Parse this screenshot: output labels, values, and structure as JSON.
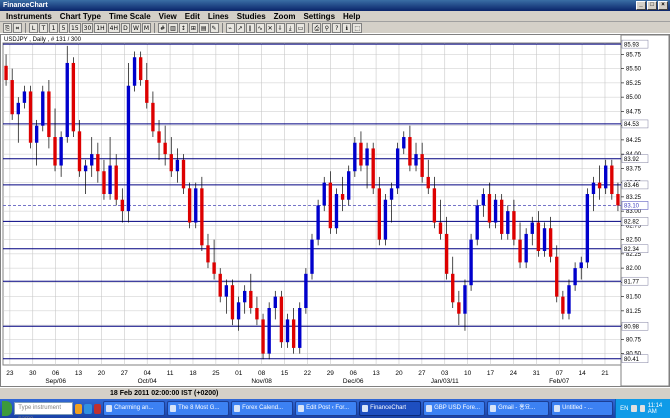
{
  "window": {
    "title": "FinanceChart"
  },
  "menu": [
    "Instruments",
    "Chart Type",
    "Time Scale",
    "View",
    "Edit",
    "Lines",
    "Studies",
    "Zoom",
    "Settings",
    "Help"
  ],
  "toolbar": {
    "buttons": [
      "⎘",
      "⌗",
      "L",
      "T",
      "1",
      "5",
      "15",
      "30",
      "1H",
      "4H",
      "D",
      "W",
      "M",
      "#",
      "▥",
      "↕",
      "⊞",
      "▤",
      "✎",
      "⌁",
      "↗",
      "∥",
      "∿",
      "✕",
      "⇩",
      "⤓",
      "▭",
      "⎙",
      "⚲",
      "?",
      "ℹ",
      "⬚"
    ]
  },
  "chart_info": "USDJPY , Daily , # 131 / 300",
  "status": {
    "datetime": "18 Feb 2011 02:00:00  IST (+0200)"
  },
  "taskbar": {
    "search_placeholder": "Type instrument name",
    "items": [
      "Charming an...",
      "The 8 Most G...",
      "Forex Calend...",
      "Edit Post ‹ For...",
      "FinanceChart",
      "GBP USD Fore...",
      "Gmail - 홍요...",
      "Untitled - ..."
    ],
    "active_index": 4,
    "language": "EN",
    "clock": "11:14 AM"
  },
  "colors": {
    "bull": "#0000cc",
    "bear": "#dd0000",
    "support_line": "#000080",
    "current_line": "#6060c0",
    "grid": "#c8c8c8"
  },
  "chart_data": {
    "type": "candlestick",
    "instrument": "USDJPY",
    "timeframe": "Daily",
    "ylim": [
      80.3,
      85.95
    ],
    "y_ticks": [
      80.5,
      80.75,
      81.0,
      81.25,
      81.5,
      81.75,
      82.0,
      82.25,
      82.5,
      82.75,
      83.0,
      83.25,
      83.5,
      83.75,
      84.0,
      84.25,
      84.5,
      84.75,
      85.0,
      85.25,
      85.5,
      85.75
    ],
    "horizontal_levels": [
      85.93,
      84.53,
      83.92,
      83.46,
      82.82,
      82.34,
      81.77,
      80.98,
      80.41
    ],
    "current_price": 83.1,
    "x_day_labels": [
      "23",
      "30",
      "06",
      "13",
      "20",
      "27",
      "04",
      "11",
      "18",
      "25",
      "01",
      "08",
      "15",
      "22",
      "29",
      "06",
      "13",
      "20",
      "27",
      "03",
      "10",
      "17",
      "24",
      "31",
      "07",
      "14",
      "21"
    ],
    "x_month_labels": [
      {
        "label": "Sep/06",
        "at": "06"
      },
      {
        "label": "Oct/04",
        "at": "04"
      },
      {
        "label": "Nov/08",
        "at": "08"
      },
      {
        "label": "Dec/06",
        "at": "06"
      },
      {
        "label": "Jan/03/11",
        "at": "03"
      },
      {
        "label": "Feb/07",
        "at": "07"
      }
    ],
    "candles": [
      [
        85.55,
        85.75,
        85.2,
        85.3
      ],
      [
        85.3,
        85.5,
        84.6,
        84.7
      ],
      [
        84.7,
        85.0,
        84.2,
        84.9
      ],
      [
        84.9,
        85.2,
        84.8,
        85.1
      ],
      [
        85.1,
        85.2,
        84.1,
        84.2
      ],
      [
        84.2,
        84.6,
        83.8,
        84.5
      ],
      [
        84.5,
        85.2,
        84.4,
        85.1
      ],
      [
        85.1,
        85.3,
        84.1,
        84.3
      ],
      [
        84.3,
        84.8,
        83.7,
        83.8
      ],
      [
        83.8,
        84.4,
        83.6,
        84.3
      ],
      [
        84.3,
        85.9,
        84.2,
        85.6
      ],
      [
        85.6,
        85.7,
        84.3,
        84.4
      ],
      [
        84.4,
        84.6,
        83.6,
        83.7
      ],
      [
        83.7,
        83.9,
        83.3,
        83.8
      ],
      [
        83.8,
        84.3,
        83.6,
        84.0
      ],
      [
        84.0,
        84.2,
        83.5,
        83.7
      ],
      [
        83.7,
        83.9,
        83.2,
        83.3
      ],
      [
        83.3,
        84.3,
        83.2,
        83.8
      ],
      [
        83.8,
        84.0,
        83.1,
        83.2
      ],
      [
        83.2,
        83.4,
        82.8,
        83.0
      ],
      [
        83.0,
        85.6,
        82.8,
        85.2
      ],
      [
        85.2,
        85.8,
        85.1,
        85.7
      ],
      [
        85.7,
        85.8,
        85.2,
        85.3
      ],
      [
        85.3,
        85.6,
        84.8,
        84.9
      ],
      [
        84.9,
        85.1,
        84.3,
        84.4
      ],
      [
        84.4,
        84.6,
        83.9,
        84.2
      ],
      [
        84.2,
        84.5,
        83.8,
        84.0
      ],
      [
        84.0,
        84.3,
        83.6,
        83.7
      ],
      [
        83.7,
        84.1,
        83.5,
        83.9
      ],
      [
        83.9,
        84.0,
        83.3,
        83.4
      ],
      [
        83.4,
        83.5,
        82.7,
        82.8
      ],
      [
        82.8,
        83.5,
        82.7,
        83.4
      ],
      [
        83.4,
        83.6,
        82.3,
        82.4
      ],
      [
        82.4,
        82.6,
        82.0,
        82.1
      ],
      [
        82.1,
        82.5,
        81.8,
        81.9
      ],
      [
        81.9,
        82.0,
        81.4,
        81.5
      ],
      [
        81.5,
        81.8,
        81.2,
        81.7
      ],
      [
        81.7,
        81.8,
        81.0,
        81.1
      ],
      [
        81.1,
        81.5,
        80.9,
        81.4
      ],
      [
        81.4,
        81.7,
        81.2,
        81.6
      ],
      [
        81.6,
        81.9,
        81.2,
        81.3
      ],
      [
        81.3,
        81.5,
        81.0,
        81.1
      ],
      [
        81.1,
        81.2,
        80.4,
        80.5
      ],
      [
        80.5,
        81.4,
        80.4,
        81.3
      ],
      [
        81.3,
        81.6,
        81.1,
        81.5
      ],
      [
        81.5,
        81.6,
        80.6,
        80.7
      ],
      [
        80.7,
        81.2,
        80.6,
        81.1
      ],
      [
        81.1,
        81.3,
        80.5,
        80.6
      ],
      [
        80.6,
        81.4,
        80.5,
        81.3
      ],
      [
        81.3,
        82.0,
        81.2,
        81.9
      ],
      [
        81.9,
        82.6,
        81.8,
        82.5
      ],
      [
        82.5,
        83.2,
        82.4,
        83.1
      ],
      [
        83.1,
        83.6,
        83.0,
        83.5
      ],
      [
        83.5,
        83.7,
        82.6,
        82.7
      ],
      [
        82.7,
        83.4,
        82.6,
        83.3
      ],
      [
        83.3,
        83.6,
        83.0,
        83.2
      ],
      [
        83.2,
        83.8,
        83.1,
        83.7
      ],
      [
        83.7,
        84.3,
        83.6,
        84.2
      ],
      [
        84.2,
        84.4,
        83.7,
        83.8
      ],
      [
        83.8,
        84.2,
        83.4,
        84.1
      ],
      [
        84.1,
        84.2,
        83.3,
        83.4
      ],
      [
        83.4,
        83.6,
        82.4,
        82.5
      ],
      [
        82.5,
        83.3,
        82.4,
        83.2
      ],
      [
        83.2,
        83.5,
        82.8,
        83.4
      ],
      [
        83.4,
        84.2,
        83.3,
        84.1
      ],
      [
        84.1,
        84.4,
        84.0,
        84.3
      ],
      [
        84.3,
        84.5,
        83.7,
        83.8
      ],
      [
        83.8,
        84.2,
        83.7,
        84.0
      ],
      [
        84.0,
        84.2,
        83.5,
        83.6
      ],
      [
        83.6,
        83.9,
        83.3,
        83.4
      ],
      [
        83.4,
        83.6,
        82.7,
        82.8
      ],
      [
        82.8,
        83.2,
        82.5,
        82.6
      ],
      [
        82.6,
        82.9,
        81.8,
        81.9
      ],
      [
        81.9,
        82.2,
        81.3,
        81.4
      ],
      [
        81.4,
        81.6,
        81.0,
        81.2
      ],
      [
        81.2,
        81.8,
        80.9,
        81.7
      ],
      [
        81.7,
        82.6,
        81.6,
        82.5
      ],
      [
        82.5,
        83.2,
        82.4,
        83.1
      ],
      [
        83.1,
        83.4,
        82.9,
        83.3
      ],
      [
        83.3,
        83.5,
        82.7,
        82.8
      ],
      [
        82.8,
        83.3,
        82.7,
        83.2
      ],
      [
        83.2,
        83.3,
        82.5,
        82.6
      ],
      [
        82.6,
        83.1,
        82.5,
        83.0
      ],
      [
        83.0,
        83.2,
        82.4,
        82.5
      ],
      [
        82.5,
        82.8,
        82.0,
        82.1
      ],
      [
        82.1,
        82.7,
        82.0,
        82.6
      ],
      [
        82.6,
        82.9,
        82.4,
        82.8
      ],
      [
        82.8,
        83.0,
        82.2,
        82.3
      ],
      [
        82.3,
        82.8,
        82.2,
        82.7
      ],
      [
        82.7,
        82.9,
        82.1,
        82.2
      ],
      [
        82.2,
        82.4,
        81.4,
        81.5
      ],
      [
        81.5,
        81.6,
        81.1,
        81.2
      ],
      [
        81.2,
        81.8,
        81.1,
        81.7
      ],
      [
        81.7,
        82.1,
        81.6,
        82.0
      ],
      [
        82.0,
        82.2,
        81.8,
        82.1
      ],
      [
        82.1,
        83.4,
        82.0,
        83.3
      ],
      [
        83.3,
        83.6,
        83.0,
        83.5
      ],
      [
        83.5,
        83.8,
        83.2,
        83.4
      ],
      [
        83.4,
        83.9,
        83.3,
        83.8
      ],
      [
        83.8,
        83.9,
        83.2,
        83.3
      ],
      [
        83.3,
        83.5,
        83.0,
        83.1
      ]
    ]
  }
}
